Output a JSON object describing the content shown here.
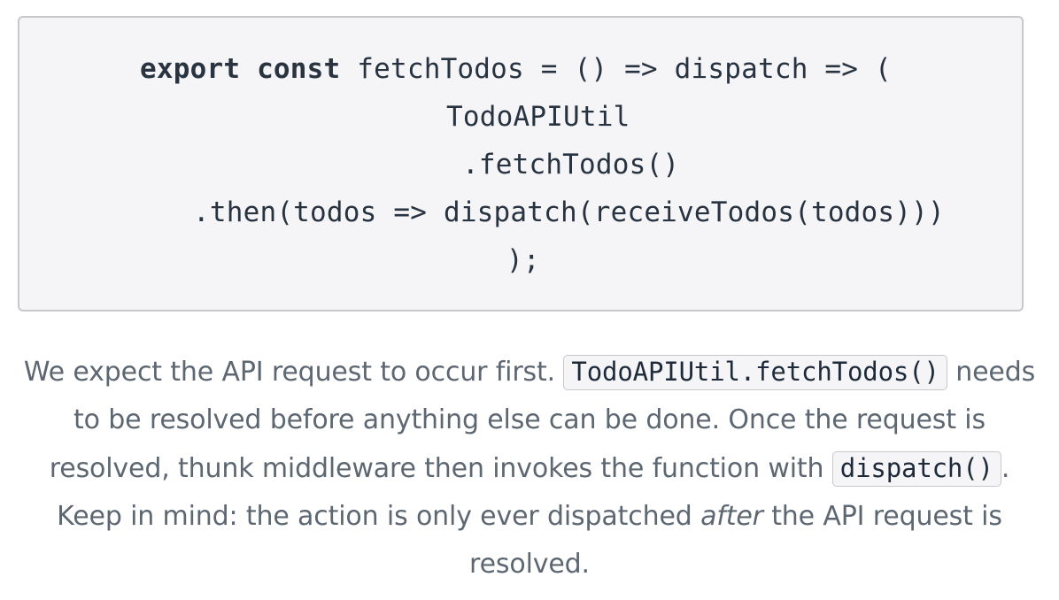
{
  "code_block": {
    "line1_kw_export": "export",
    "line1_kw_const": "const",
    "line1_rest": " fetchTodos = () => dispatch => (",
    "line2": "TodoAPIUtil",
    "line3": ".fetchTodos()",
    "line4": ".then(todos => dispatch(receiveTodos(todos)))",
    "line5": ");"
  },
  "paragraph": {
    "part1": "We expect the API request to occur first. ",
    "code1": "TodoAPIUtil.fetchTodos()",
    "part2": " needs to be resolved before anything else can be done. Once the request is resolved, thunk middleware then invokes the function with ",
    "code2": "dispatch()",
    "part3": ". Keep in mind: the action is only ever dispatched ",
    "emphasis": "after",
    "part4": " the API request is resolved."
  }
}
